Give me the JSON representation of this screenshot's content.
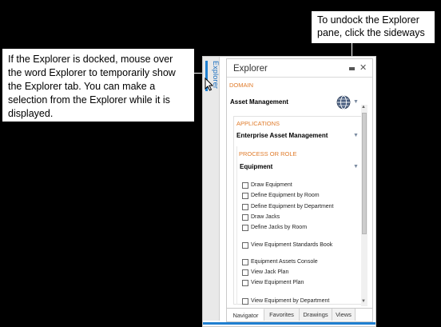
{
  "callouts": {
    "left": "If the Explorer is docked, mouse over the word Explorer to temporarily show the Explorer tab. You can make a selection from the Explorer while it is displayed.",
    "top": "To undock the Explorer pane, click the sideways"
  },
  "side_tab": {
    "label": "Explorer"
  },
  "panel": {
    "title": "Explorer",
    "domain_heading": "DOMAIN",
    "domain_value": "Asset Management",
    "applications_heading": "APPLICATIONS",
    "applications_value": "Enterprise Asset Management",
    "process_heading": "PROCESS OR ROLE",
    "process_value": "Equipment",
    "items": [
      "Draw Equipment",
      "Define Equipment by Room",
      "Define Equipment by Department",
      "Draw Jacks",
      "Define Jacks by Room",
      "View Equipment Standards Book",
      "Equipment Assets Console",
      "View Jack Plan",
      "View Equipment Plan",
      "View Equipment by Department"
    ]
  },
  "tabs": [
    "Navigator",
    "Favorites",
    "Drawings",
    "Views"
  ],
  "icons": {
    "pin": "minimize-icon",
    "close": "close-icon",
    "globe": "globe-icon",
    "cursor": "mouse-pointer-icon",
    "dropdown": "chevron-down-icon"
  },
  "colors": {
    "accent": "#1f7fd0",
    "heading": "#e07b2a",
    "background": "#000000"
  }
}
